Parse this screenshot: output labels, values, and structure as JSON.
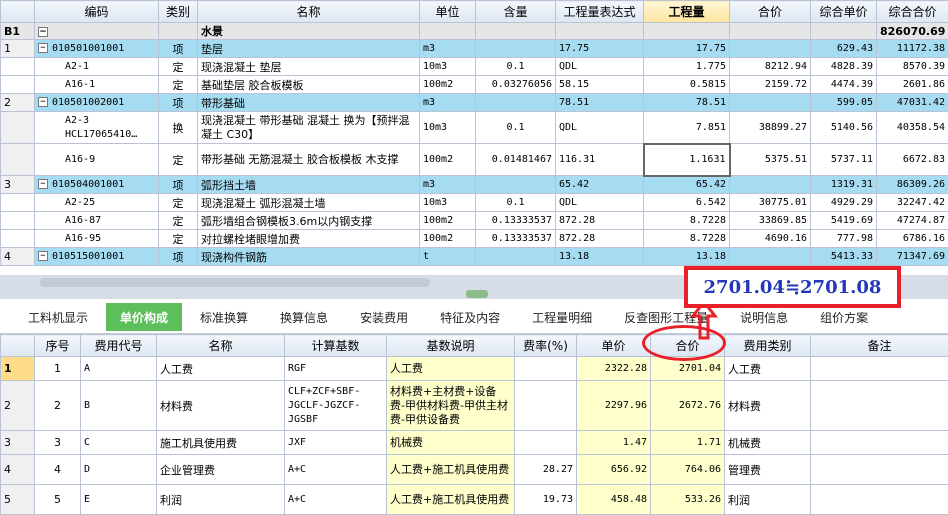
{
  "top_table": {
    "headers": [
      "",
      "编码",
      "类别",
      "名称",
      "单位",
      "含量",
      "工程量表达式",
      "工程量",
      "合价",
      "综合单价",
      "综合合价"
    ],
    "section": {
      "row": "B1",
      "name": "水景",
      "total": "826070.69"
    },
    "rows": [
      {
        "kind": "q",
        "rn": "1",
        "code": "010501001001",
        "cat": "项",
        "name": "垫层",
        "unit": "m3",
        "qty": "",
        "expr": "17.75",
        "amount": "17.75",
        "total_price": "",
        "unit_price": "629.43",
        "sum": "11172.38"
      },
      {
        "kind": "d",
        "rn": "",
        "code": "A2-1",
        "cat": "定",
        "name": "现浇混凝土 垫层",
        "unit": "10m3",
        "qty": "0.1",
        "expr": "QDL",
        "amount": "1.775",
        "total_price": "8212.94",
        "unit_price": "4828.39",
        "sum": "8570.39"
      },
      {
        "kind": "d",
        "rn": "",
        "code": "A16-1",
        "cat": "定",
        "name": "基础垫层 胶合板模板",
        "unit": "100m2",
        "qty": "0.03276056",
        "expr": "58.15",
        "amount": "0.5815",
        "total_price": "2159.72",
        "unit_price": "4474.39",
        "sum": "2601.86"
      },
      {
        "kind": "q",
        "rn": "2",
        "code": "010501002001",
        "cat": "项",
        "name": "带形基础",
        "unit": "m3",
        "qty": "",
        "expr": "78.51",
        "amount": "78.51",
        "total_price": "",
        "unit_price": "599.05",
        "sum": "47031.42"
      },
      {
        "kind": "d2",
        "rn": "",
        "code": "A2-3 HCL17065410…",
        "cat": "换",
        "name": "现浇混凝土 带形基础 混凝土  换为【预拌混凝土 C30】",
        "unit": "10m3",
        "qty": "0.1",
        "expr": "QDL",
        "amount": "7.851",
        "total_price": "38899.27",
        "unit_price": "5140.56",
        "sum": "40358.54"
      },
      {
        "kind": "d2",
        "rn": "",
        "code": "A16-9",
        "cat": "定",
        "name": "带形基础 无筋混凝土 胶合板模板 木支撑",
        "unit": "100m2",
        "qty": "0.01481467",
        "expr": "116.31",
        "amount": "1.1631",
        "total_price": "5375.51",
        "unit_price": "5737.11",
        "sum": "6672.83"
      },
      {
        "kind": "q",
        "rn": "3",
        "code": "010504001001",
        "cat": "项",
        "name": "弧形挡土墙",
        "unit": "m3",
        "qty": "",
        "expr": "65.42",
        "amount": "65.42",
        "total_price": "",
        "unit_price": "1319.31",
        "sum": "86309.26"
      },
      {
        "kind": "d",
        "rn": "",
        "code": "A2-25",
        "cat": "定",
        "name": "现浇混凝土 弧形混凝土墙",
        "unit": "10m3",
        "qty": "0.1",
        "expr": "QDL",
        "amount": "6.542",
        "total_price": "30775.01",
        "unit_price": "4929.29",
        "sum": "32247.42"
      },
      {
        "kind": "d",
        "rn": "",
        "code": "A16-87",
        "cat": "定",
        "name": "弧形墙组合钢模板3.6m以内钢支撑",
        "unit": "100m2",
        "qty": "0.13333537",
        "expr": "872.28",
        "amount": "8.7228",
        "total_price": "33869.85",
        "unit_price": "5419.69",
        "sum": "47274.87"
      },
      {
        "kind": "d",
        "rn": "",
        "code": "A16-95",
        "cat": "定",
        "name": "对拉螺栓堵眼增加费",
        "unit": "100m2",
        "qty": "0.13333537",
        "expr": "872.28",
        "amount": "8.7228",
        "total_price": "4690.16",
        "unit_price": "777.98",
        "sum": "6786.16"
      },
      {
        "kind": "q",
        "rn": "4",
        "code": "010515001001",
        "cat": "项",
        "name": "现浇构件钢筋",
        "unit": "t",
        "qty": "",
        "expr": "13.18",
        "amount": "13.18",
        "total_price": "",
        "unit_price": "5413.33",
        "sum": "71347.69"
      }
    ]
  },
  "tabs": [
    "工料机显示",
    "单价构成",
    "标准换算",
    "换算信息",
    "安装费用",
    "特征及内容",
    "工程量明细",
    "反查图形工程量",
    "说明信息",
    "组价方案"
  ],
  "active_tab": "单价构成",
  "bottom_table": {
    "headers": [
      "",
      "序号",
      "费用代号",
      "名称",
      "计算基数",
      "基数说明",
      "费率(%)",
      "单价",
      "合价",
      "费用类别",
      "备注"
    ],
    "rows": [
      {
        "rn": "1",
        "seq": "1",
        "code": "A",
        "name": "人工费",
        "base": "RGF",
        "desc": "人工费",
        "rate": "",
        "price": "2322.28",
        "total": "2701.04",
        "type": "人工费",
        "note": ""
      },
      {
        "rn": "2",
        "seq": "2",
        "code": "B",
        "name": "材料费",
        "base": "CLF+ZCF+SBF-JGCLF-JGZCF-JGSBF",
        "desc": "材料费+主材费+设备费-甲供材料费-甲供主材费-甲供设备费",
        "rate": "",
        "price": "2297.96",
        "total": "2672.76",
        "type": "材料费",
        "note": ""
      },
      {
        "rn": "3",
        "seq": "3",
        "code": "C",
        "name": "施工机具使用费",
        "base": "JXF",
        "desc": "机械费",
        "rate": "",
        "price": "1.47",
        "total": "1.71",
        "type": "机械费",
        "note": ""
      },
      {
        "rn": "4",
        "seq": "4",
        "code": "D",
        "name": "企业管理费",
        "base": "A+C",
        "desc": "人工费+施工机具使用费",
        "rate": "28.27",
        "price": "656.92",
        "total": "764.06",
        "type": "管理费",
        "note": ""
      },
      {
        "rn": "5",
        "seq": "5",
        "code": "E",
        "name": "利润",
        "base": "A+C",
        "desc": "人工费+施工机具使用费",
        "rate": "19.73",
        "price": "458.48",
        "total": "533.26",
        "type": "利润",
        "note": ""
      }
    ]
  },
  "annotation": {
    "text": "2701.04≒2701.08",
    "color": "#e8202a",
    "text_color": "#2437b8"
  },
  "colors": {
    "item_row": "#a6dcf2",
    "active_tab": "#5cbf5c",
    "highlight_cell": "#ffffcc"
  }
}
